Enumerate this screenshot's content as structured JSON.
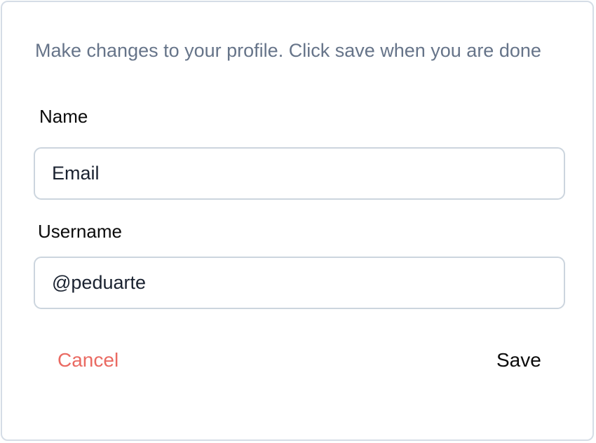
{
  "dialog": {
    "description": "Make changes to your profile. Click save when you are done",
    "fields": {
      "name": {
        "label": "Name",
        "value": "Email"
      },
      "username": {
        "label": "Username",
        "value": "@peduarte"
      }
    },
    "actions": {
      "cancel_label": "Cancel",
      "save_label": "Save"
    }
  },
  "colors": {
    "border": "#d5dde6",
    "description_text": "#667489",
    "cancel": "#ea6a62",
    "text": "#0b0b0b"
  }
}
